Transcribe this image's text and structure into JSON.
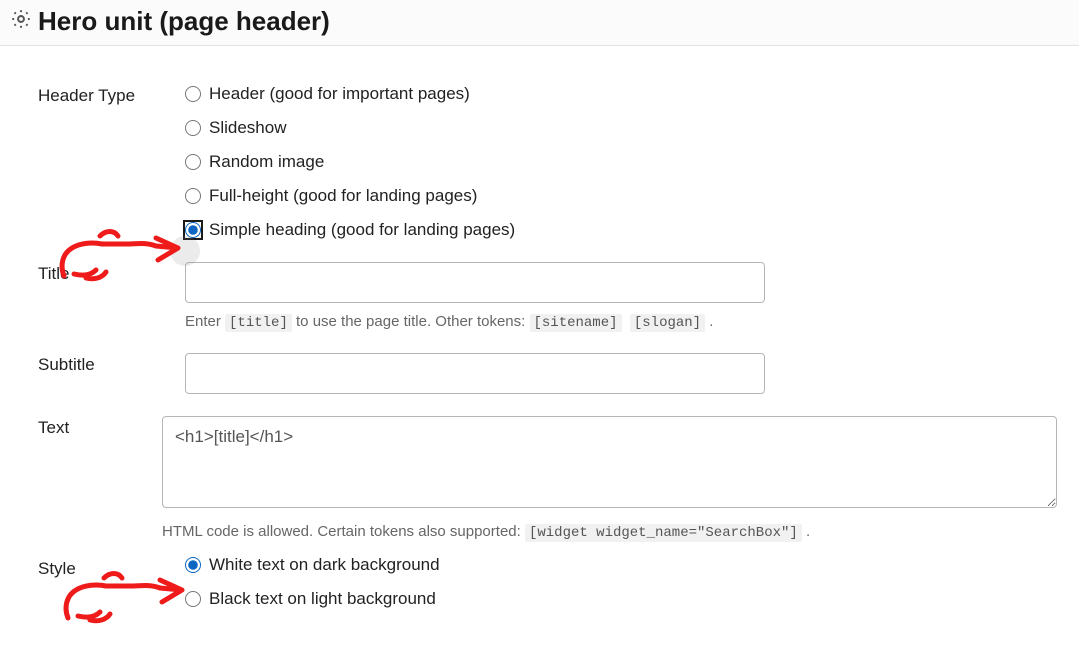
{
  "panel": {
    "title": "Hero unit (page header)"
  },
  "fields": {
    "header_type": {
      "label": "Header Type",
      "options": {
        "o0": "Header (good for important pages)",
        "o1": "Slideshow",
        "o2": "Random image",
        "o3": "Full-height (good for landing pages)",
        "o4": "Simple heading (good for landing pages)"
      }
    },
    "title": {
      "label": "Title",
      "value": "",
      "help_pre": "Enter ",
      "help_t1": "[title]",
      "help_mid": " to use the page title. Other tokens: ",
      "help_t2": "[sitename]",
      "help_t3": "[slogan]",
      "help_end": " ."
    },
    "subtitle": {
      "label": "Subtitle",
      "value": ""
    },
    "text": {
      "label": "Text",
      "value": "<h1>[title]</h1>",
      "help_pre": "HTML code is allowed. Certain tokens also supported: ",
      "help_t1": "[widget widget_name=\"SearchBox\"]",
      "help_end": " ."
    },
    "style": {
      "label": "Style",
      "options": {
        "o0": "White text on dark background",
        "o1": "Black text on light background"
      }
    }
  }
}
